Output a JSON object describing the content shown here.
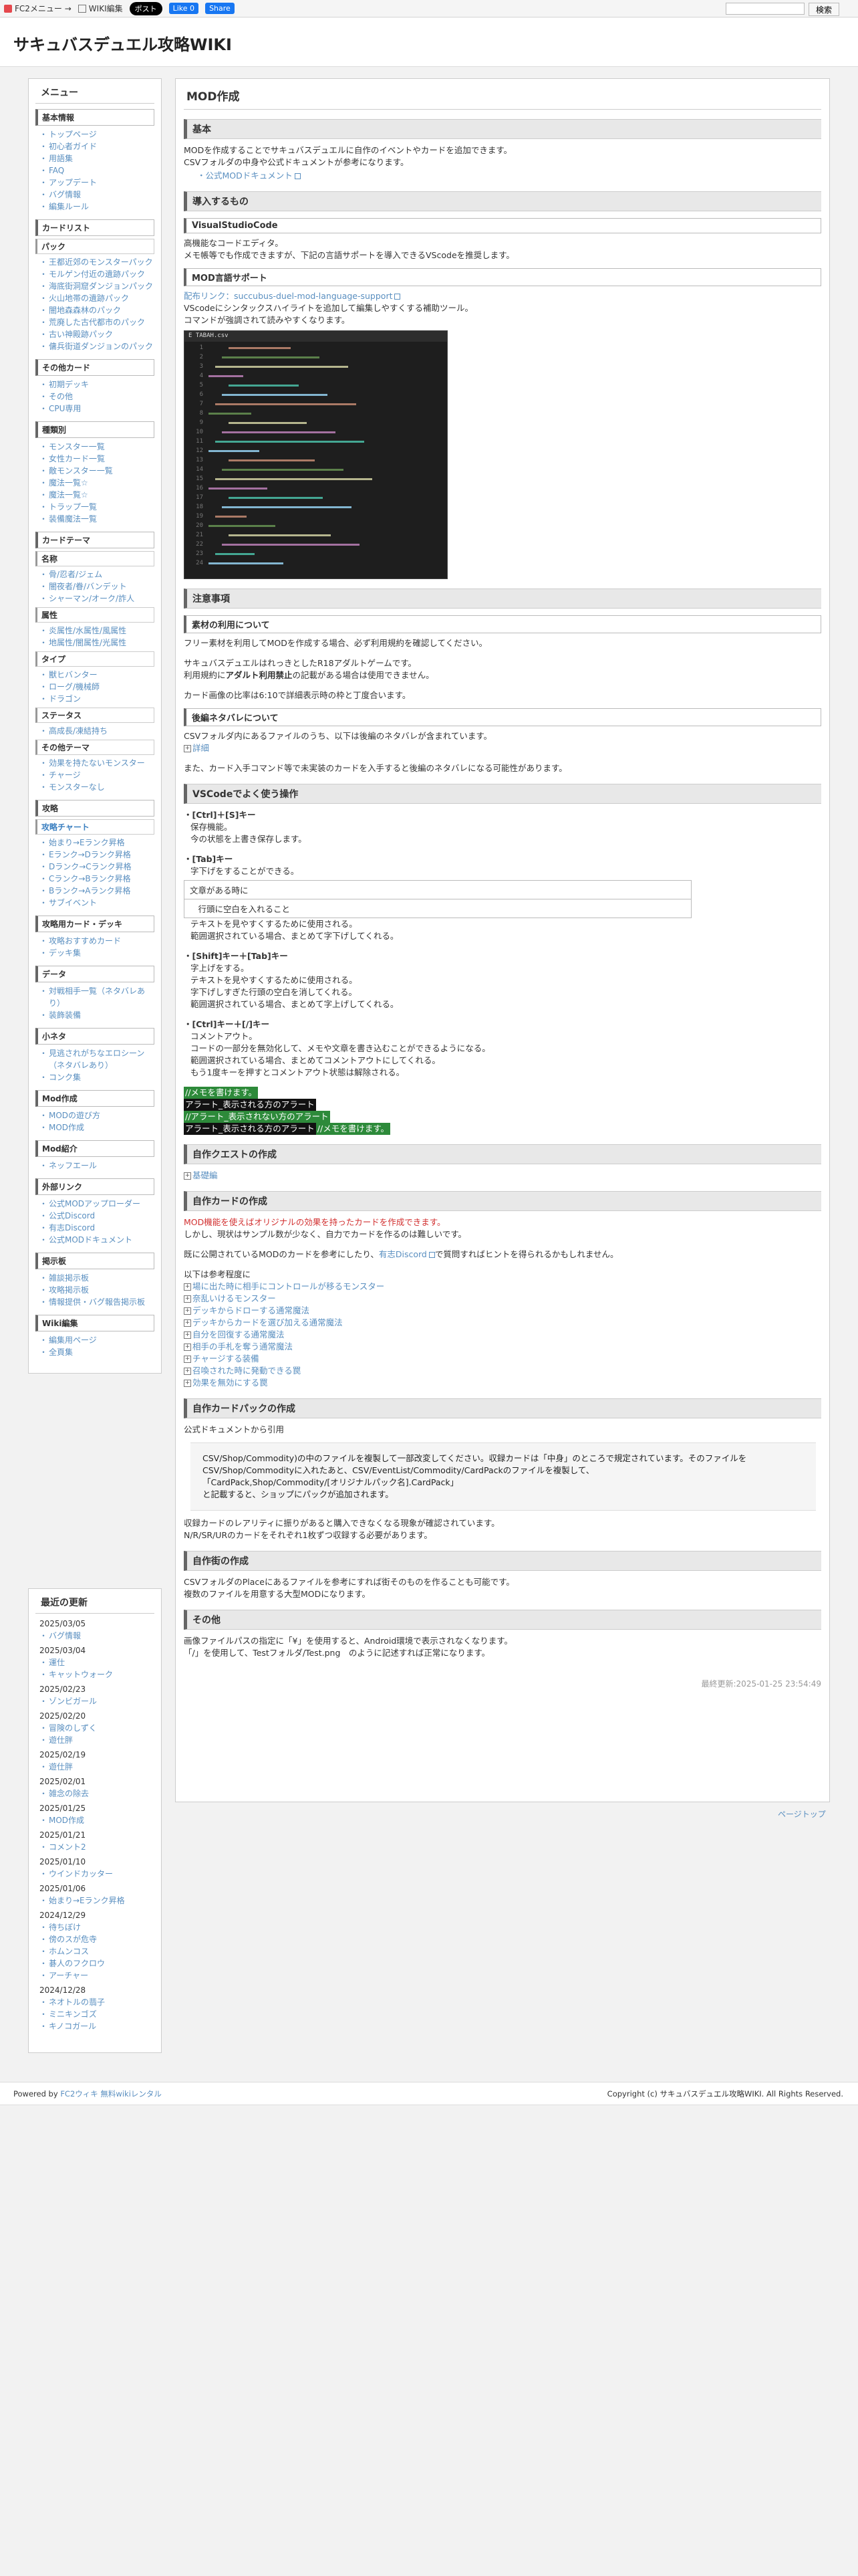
{
  "topbar": {
    "fc2_menu": "FC2メニュー →",
    "wiki_edit": "WIKI編集",
    "post": "ポスト",
    "like": "Like 0",
    "share": "Share",
    "search_button": "検索"
  },
  "site_title": "サキュバスデュエル攻略WIKI",
  "menu": {
    "title": "メニュー",
    "groups": [
      {
        "head": "基本情報",
        "items": [
          "トップページ",
          "初心者ガイド",
          "用語集",
          "FAQ",
          "アップデート",
          "バグ情報",
          "編集ルール"
        ]
      },
      {
        "head": "カードリスト",
        "subs": [
          {
            "name": "パック",
            "items": [
              "王都近郊のモンスターパック",
              "モルゲン付近の遺跡パック",
              "海底街洞窟ダンジョンパック",
              "火山地帯の遺跡パック",
              "闇地森森林のパック",
              "荒廃した古代都市のパック",
              "古い神殿跡パック",
              "傭兵街道ダンジョンのパック"
            ]
          }
        ]
      },
      {
        "head": "その他カード",
        "items": [
          "初期デッキ",
          "その他",
          "CPU専用"
        ]
      },
      {
        "head": "種類別",
        "items": [
          "モンスター一覧",
          "女性カード一覧",
          "敵モンスター一覧",
          "魔法一覧☆",
          "魔法一覧☆",
          "トラップ一覧",
          "装備魔法一覧"
        ]
      },
      {
        "head": "カードテーマ",
        "subs": [
          {
            "name": "名称",
            "items": [
              "骨/忍者/ジェム",
              "闇夜者/眷/バンデット",
              "シャーマン/オーク/詐人"
            ]
          },
          {
            "name": "属性",
            "items": [
              "炎属性/水属性/風属性",
              "地属性/闇属性/光属性"
            ]
          },
          {
            "name": "タイプ",
            "items": [
              "獣ヒバンター",
              "ローグ/機械師",
              "ドラゴン"
            ]
          },
          {
            "name": "ステータス",
            "items": [
              "高成長/凍結持ち"
            ]
          },
          {
            "name": "その他テーマ",
            "items": [
              "効果を持たないモンスター",
              "チャージ",
              "モンスターなし"
            ]
          }
        ]
      },
      {
        "head": "攻略",
        "subs": [
          {
            "name": "攻略チャート",
            "blue": true,
            "items": [
              "始まり→Eランク昇格",
              "Eランク→Dランク昇格",
              "Dランク→Cランク昇格",
              "Cランク→Bランク昇格",
              "Bランク→Aランク昇格",
              "サブイベント"
            ]
          }
        ]
      },
      {
        "head": "攻略用カード・デッキ",
        "items": [
          "攻略おすすめカード",
          "デッキ集"
        ]
      },
      {
        "head": "データ",
        "items": [
          "対戦相手一覧（ネタバレあり）",
          "装飾装備"
        ]
      },
      {
        "head": "小ネタ",
        "items": [
          "見逃されがちなエロシーン（ネタバレあり）",
          "コンク集"
        ]
      },
      {
        "head": "Mod作成",
        "items": [
          "MODの遊び方",
          "MOD作成"
        ]
      },
      {
        "head": "Mod紹介",
        "items": [
          "ネッフエール"
        ]
      },
      {
        "head": "外部リンク",
        "items": [
          "公式MODアップローダー",
          "公式Discord",
          "有志Discord",
          "公式MODドキュメント"
        ]
      },
      {
        "head": "掲示板",
        "items": [
          "雑談掲示板",
          "攻略掲示板",
          "情報提供・バグ報告掲示板"
        ]
      },
      {
        "head": "Wiki編集",
        "items": [
          "編集用ページ",
          "全頁集"
        ]
      }
    ]
  },
  "recent": {
    "title": "最近の更新",
    "entries": [
      {
        "date": "2025/03/05",
        "items": [
          "バグ情報"
        ]
      },
      {
        "date": "2025/03/04",
        "items": [
          "運仕",
          "キャットウォーク"
        ]
      },
      {
        "date": "2025/02/23",
        "items": [
          "ゾンビガール"
        ]
      },
      {
        "date": "2025/02/20",
        "items": [
          "冒険のしずく",
          "遊仕胖"
        ]
      },
      {
        "date": "2025/02/19",
        "items": [
          "遊仕胖"
        ]
      },
      {
        "date": "2025/02/01",
        "items": [
          "雑念の除去"
        ]
      },
      {
        "date": "2025/01/25",
        "items": [
          "MOD作成"
        ]
      },
      {
        "date": "2025/01/21",
        "items": [
          "コメント2"
        ]
      },
      {
        "date": "2025/01/10",
        "items": [
          "ウインドカッター"
        ]
      },
      {
        "date": "2025/01/06",
        "items": [
          "始まり→Eランク昇格"
        ]
      },
      {
        "date": "2024/12/29",
        "items": [
          "待ちぼけ",
          "傍のスが危寺",
          "ホムンコス",
          "碁人のフクロウ",
          "アーチャー"
        ]
      },
      {
        "date": "2024/12/28",
        "items": [
          "ネオトルの翡子",
          "ミニキンゴズ",
          "キノコガール"
        ]
      }
    ]
  },
  "main": {
    "page_title": "MOD作成",
    "s_basic": "基本",
    "basic_p1": "MODを作成することでサキュバスデュエルに自作のイベントやカードを追加できます。",
    "basic_p2": "CSVフォルダの中身や公式ドキュメントが参考になります。",
    "basic_link": "公式MODドキュメント",
    "s_tools": "導入するもの",
    "vsc": "VisualStudioCode",
    "vsc_p1": "高機能なコードエディタ。",
    "vsc_p2": "メモ帳等でも作成できますが、下記の言語サポートを導入できるVScodeを推奨します。",
    "lang_head": "MOD言語サポート",
    "lang_link": "配布リンク：succubus-duel-mod-language-support",
    "lang_p1": "VScodeにシンタックスハイライトを追加して編集しやすくする補助ツール。",
    "lang_p2": "コマンドが強調されて読みやすくなります。",
    "shot_tab": "E TABAH.csv",
    "s_notes": "注意事項",
    "material": "素材の利用について",
    "mat_p1": "フリー素材を利用してMODを作成する場合、必ず利用規約を確認してください。",
    "mat_p2": "サキュバスデュエルはれっきとしたR18アダルトゲームです。",
    "mat_p3a": "利用規約に",
    "mat_p3b": "アダルト利用禁止",
    "mat_p3c": "の記載がある場合は使用できません。",
    "mat_p4": "カード画像の比率は6:10で詳細表示時の枠と丁度合います。",
    "spoiler": "後編ネタバレについて",
    "sp_p1": "CSVフォルダ内にあるファイルのうち、以下は後編のネタバレが含まれています。",
    "sp_detail": "詳細",
    "sp_p2": "また、カード入手コマンド等で未実装のカードを入手すると後編のネタバレになる可能性があります。",
    "s_vsc_ops": "VSCodeでよく使う操作",
    "op1_key": "・[Ctrl]＋[S]キー",
    "op1_a": "保存機能。",
    "op1_b": "今の状態を上書き保存します。",
    "op2_key": "・[Tab]キー",
    "op2_a": "字下げをすることができる。",
    "op2_box1": "文章がある時に",
    "op2_box2": "　行頭に空白を入れること",
    "op2_b": "テキストを見やすくするために使用される。",
    "op2_c": "範囲選択されている場合、まとめて字下げしてくれる。",
    "op3_key": "・[Shift]キー＋[Tab]キー",
    "op3_a": "字上げをする。",
    "op3_b": "テキストを見やすくするために使用される。",
    "op3_c": "字下げしすぎた行頭の空白を消してくれる。",
    "op3_d": "範囲選択されている場合、まとめて字上げしてくれる。",
    "op4_key": "・[Ctrl]キー＋[/]キー",
    "op4_a": "コメントアウト。",
    "op4_b": "コードの一部分を無効化して、メモや文章を書き込むことができるようになる。",
    "op4_c": "範囲選択されている場合、まとめてコメントアウトにしてくれる。",
    "op4_d": "もう1度キーを押すとコメントアウト状態は解除される。",
    "hl1": "//メモを書けます。",
    "hl2": "アラート_表示される方のアラート",
    "hl3": "//アラート_表示されない方のアラート",
    "hl4a": "アラート_表示される方のアラート",
    "hl4b": "//メモを書けます。",
    "s_quest": "自作クエストの作成",
    "quest_link": "基礎編",
    "s_card": "自作カードの作成",
    "card_p1": "MOD機能を使えばオリジナルの効果を持ったカードを作成できます。",
    "card_p2": "しかし、現状はサンプル数が少なく、自力でカードを作るのは難しいです。",
    "card_p3a": "既に公開されているMODのカードを参考にしたり、",
    "card_p3b": "有志Discord",
    "card_p3c": "で質問すればヒントを得られるかもしれません。",
    "card_p4": "以下は参考程度に",
    "card_links": [
      "場に出た時に相手にコントロールが移るモンスター",
      "奈乱いけるモンスター",
      "デッキからドローする通常魔法",
      "デッキからカードを選び加える通常魔法",
      "自分を回復する通常魔法",
      "相手の手札を奪う通常魔法",
      "チャージする装備",
      "召喚された時に発動できる罠",
      "効果を無効にする罠"
    ],
    "s_pack": "自作カードパックの作成",
    "pack_p1": "公式ドキュメントから引用",
    "pack_q1": "CSV/Shop/Commodity)の中のファイルを複製して一部改変してください。収録カードは「中身」のところで規定されています。そのファイルをCSV/Shop/Commodityに入れたあと、CSV/EventList/Commodity/CardPackのファイルを複製して、",
    "pack_q2": "「CardPack,Shop/Commodity/[オリジナルパック名].CardPack」",
    "pack_q3": "と記載すると、ショップにパックが追加されます。",
    "pack_p2": "収録カードのレアリティに振りがあると購入できなくなる現象が確認されています。",
    "pack_p3": "N/R/SR/URのカードをそれぞれ1枚ずつ収録する必要があります。",
    "s_bg": "自作街の作成",
    "bg_p1": "CSVフォルダのPlaceにあるファイルを参考にすれば街そのものを作ることも可能です。",
    "bg_p2": "複数のファイルを用意する大型MODになります。",
    "s_other": "その他",
    "other_p1": "画像ファイルパスの指定に「¥」を使用すると、Android環境で表示されなくなります。",
    "other_p2": "「/」を使用して、Testフォルダ/Test.png　のように記述すれば正常になります。",
    "updated": "最終更新:2025-01-25 23:54:49"
  },
  "pagetop": "ページトップ",
  "footer": {
    "left_a": "Powered by ",
    "left_b": "FC2ウィキ 無料wikiレンタル",
    "right": "Copyright (c) サキュバスデュエル攻略WIKI. All Rights Reserved."
  },
  "colors": {
    "accent": "#5a8fc0",
    "red": "#d23030",
    "highlight_green": "#2d8a3a"
  }
}
